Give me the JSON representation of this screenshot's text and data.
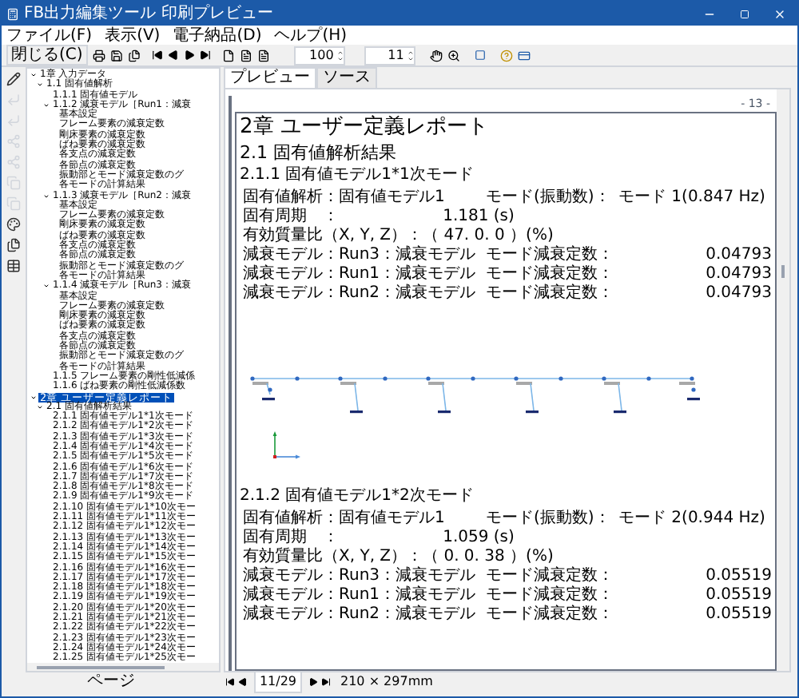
{
  "window": {
    "title": "FB出力編集ツール 印刷プレビュー"
  },
  "menu": [
    "ファイル(F)",
    "表示(V)",
    "電子納品(D)",
    "ヘルプ(H)"
  ],
  "toolbar": {
    "close_button": "閉じる(C)",
    "zoom": "100",
    "page": "11"
  },
  "side_tools": [
    {
      "disabled": false
    },
    {
      "disabled": true
    },
    {
      "disabled": true
    },
    {
      "disabled": true
    },
    {
      "disabled": true
    },
    {
      "disabled": true
    },
    {
      "disabled": true
    },
    {
      "disabled": false
    },
    {
      "disabled": false
    },
    {
      "disabled": false
    }
  ],
  "tree": [
    {
      "label": "1章 入力データ",
      "expanded": true,
      "selected": false,
      "children": [
        {
          "label": "1.1 固有値解析",
          "expanded": true,
          "selected": false,
          "children": [
            {
              "label": "1.1.1 固有値モデル",
              "selected": false
            },
            {
              "label": "1.1.2 減衰モデル［Run1：減衰",
              "expanded": true,
              "selected": false,
              "children": [
                {
                  "label": "基本設定",
                  "selected": false
                },
                {
                  "label": "フレーム要素の減衰定数",
                  "selected": false
                },
                {
                  "label": "剛床要素の減衰定数",
                  "selected": false
                },
                {
                  "label": "ばね要素の減衰定数",
                  "selected": false
                },
                {
                  "label": "各支点の減衰定数",
                  "selected": false
                },
                {
                  "label": "各節点の減衰定数",
                  "selected": false
                },
                {
                  "label": "振動部とモード減衰定数のグ",
                  "selected": false
                },
                {
                  "label": "各モードの計算結果",
                  "selected": false
                }
              ]
            },
            {
              "label": "1.1.3 減衰モデル［Run2：減衰",
              "expanded": true,
              "selected": false,
              "children": [
                {
                  "label": "基本設定",
                  "selected": false
                },
                {
                  "label": "フレーム要素の減衰定数",
                  "selected": false
                },
                {
                  "label": "剛床要素の減衰定数",
                  "selected": false
                },
                {
                  "label": "ばね要素の減衰定数",
                  "selected": false
                },
                {
                  "label": "各支点の減衰定数",
                  "selected": false
                },
                {
                  "label": "各節点の減衰定数",
                  "selected": false
                },
                {
                  "label": "振動部とモード減衰定数のグ",
                  "selected": false
                },
                {
                  "label": "各モードの計算結果",
                  "selected": false
                }
              ]
            },
            {
              "label": "1.1.4 減衰モデル［Run3：減衰",
              "expanded": true,
              "selected": false,
              "children": [
                {
                  "label": "基本設定",
                  "selected": false
                },
                {
                  "label": "フレーム要素の減衰定数",
                  "selected": false
                },
                {
                  "label": "剛床要素の減衰定数",
                  "selected": false
                },
                {
                  "label": "ばね要素の減衰定数",
                  "selected": false
                },
                {
                  "label": "各支点の減衰定数",
                  "selected": false
                },
                {
                  "label": "各節点の減衰定数",
                  "selected": false
                },
                {
                  "label": "振動部とモード減衰定数のグ",
                  "selected": false
                },
                {
                  "label": "各モードの計算結果",
                  "selected": false
                }
              ]
            },
            {
              "label": "1.1.5 フレーム要素の剛性低減係",
              "selected": false
            },
            {
              "label": "1.1.6 ばね要素の剛性低減係数",
              "selected": false
            }
          ]
        }
      ]
    },
    {
      "label": "2章 ユーザー定義レポート",
      "expanded": true,
      "selected": true,
      "children": [
        {
          "label": "2.1 固有値解析結果",
          "expanded": true,
          "selected": false,
          "children": [
            {
              "label": "2.1.1 固有値モデル1*1次モード",
              "selected": false
            },
            {
              "label": "2.1.2 固有値モデル1*2次モード",
              "selected": false
            },
            {
              "label": "2.1.3 固有値モデル1*3次モード",
              "selected": false
            },
            {
              "label": "2.1.4 固有値モデル1*4次モード",
              "selected": false
            },
            {
              "label": "2.1.5 固有値モデル1*5次モード",
              "selected": false
            },
            {
              "label": "2.1.6 固有値モデル1*6次モード",
              "selected": false
            },
            {
              "label": "2.1.7 固有値モデル1*7次モード",
              "selected": false
            },
            {
              "label": "2.1.8 固有値モデル1*8次モード",
              "selected": false
            },
            {
              "label": "2.1.9 固有値モデル1*9次モード",
              "selected": false
            },
            {
              "label": "2.1.10 固有値モデル1*10次モー",
              "selected": false
            },
            {
              "label": "2.1.11 固有値モデル1*11次モー",
              "selected": false
            },
            {
              "label": "2.1.12 固有値モデル1*12次モー",
              "selected": false
            },
            {
              "label": "2.1.13 固有値モデル1*13次モー",
              "selected": false
            },
            {
              "label": "2.1.14 固有値モデル1*14次モー",
              "selected": false
            },
            {
              "label": "2.1.15 固有値モデル1*15次モー",
              "selected": false
            },
            {
              "label": "2.1.16 固有値モデル1*16次モー",
              "selected": false
            },
            {
              "label": "2.1.17 固有値モデル1*17次モー",
              "selected": false
            },
            {
              "label": "2.1.18 固有値モデル1*18次モー",
              "selected": false
            },
            {
              "label": "2.1.19 固有値モデル1*19次モー",
              "selected": false
            },
            {
              "label": "2.1.20 固有値モデル1*20次モー",
              "selected": false
            },
            {
              "label": "2.1.21 固有値モデル1*21次モー",
              "selected": false
            },
            {
              "label": "2.1.22 固有値モデル1*22次モー",
              "selected": false
            },
            {
              "label": "2.1.23 固有値モデル1*23次モー",
              "selected": false
            },
            {
              "label": "2.1.24 固有値モデル1*24次モー",
              "selected": false
            },
            {
              "label": "2.1.25 固有値モデル1*25次モー",
              "selected": false
            }
          ]
        }
      ]
    }
  ],
  "status_bar": "ページ",
  "tabs": [
    {
      "label": "プレビュー",
      "selected": true
    },
    {
      "label": "ソース",
      "selected": false
    }
  ],
  "document": {
    "page_number": "- 13 -",
    "chapter": "2章 ユーザー定義レポート",
    "section": "2.1 固有値解析結果",
    "subsections": [
      {
        "title": "2.1.1 固有値モデル1*1次モード",
        "has_figure": true,
        "rows": [
          [
            "固有値解析",
            "：",
            "固有値モデル1",
            "モード(振動数)：",
            "モード 1(0.847 Hz)"
          ],
          [
            "固有周期",
            "：",
            "1.181 (s)"
          ],
          [
            "有効質量比（X, Y, Z）：（ 47.  0.  0 ）(%)"
          ],
          [
            "減衰モデル",
            "：",
            "Run3：減衰モデル",
            "モード減衰定数：",
            "0.04793"
          ],
          [
            "減衰モデル",
            "：",
            "Run1：減衰モデル",
            "モード減衰定数：",
            "0.04793"
          ],
          [
            "減衰モデル",
            "：",
            "Run2：減衰モデル",
            "モード減衰定数：",
            "0.04793"
          ]
        ]
      },
      {
        "title": "2.1.2 固有値モデル1*2次モード",
        "has_figure": false,
        "rows": [
          [
            "固有値解析",
            "：",
            "固有値モデル1",
            "モード(振動数)：",
            "モード 2(0.944 Hz)"
          ],
          [
            "固有周期",
            "：",
            "1.059 (s)"
          ],
          [
            "有効質量比（X, Y, Z）：（ 0.  0.  38 ）(%)"
          ],
          [
            "減衰モデル",
            "：",
            "Run3：減衰モデル",
            "モード減衰定数：",
            "0.05519"
          ],
          [
            "減衰モデル",
            "：",
            "Run1：減衰モデル",
            "モード減衰定数：",
            "0.05519"
          ],
          [
            "減衰モデル",
            "：",
            "Run2：減衰モデル",
            "モード減衰定数：",
            "0.05519"
          ]
        ]
      }
    ]
  },
  "navigator": {
    "page": "11/29",
    "paper": "210 × 297mm"
  }
}
